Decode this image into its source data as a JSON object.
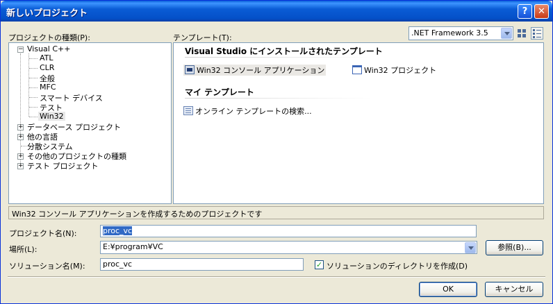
{
  "window": {
    "title": "新しいプロジェクト",
    "help_glyph": "?",
    "close_glyph": "✕"
  },
  "labels": {
    "project_types": "プロジェクトの種類(P):",
    "templates": "テンプレート(T):"
  },
  "framework": {
    "selected": ".NET Framework 3.5"
  },
  "tree": {
    "root": {
      "label": "Visual C++",
      "expander": "−"
    },
    "children": [
      "ATL",
      "CLR",
      "全般",
      "MFC",
      "スマート デバイス",
      "テスト",
      "Win32"
    ],
    "top_items": [
      {
        "label": "データベース プロジェクト",
        "expander": "+"
      },
      {
        "label": "他の言語",
        "expander": "+"
      },
      {
        "label": "分散システム",
        "expander": ""
      },
      {
        "label": "その他のプロジェクトの種類",
        "expander": "+"
      },
      {
        "label": "テスト プロジェクト",
        "expander": "+"
      }
    ]
  },
  "templates": {
    "installed_header": "Visual Studio にインストールされたテンプレート",
    "installed": [
      {
        "label": "Win32 コンソール アプリケーション",
        "icon": "console-app-icon"
      },
      {
        "label": "Win32 プロジェクト",
        "icon": "win32-project-icon"
      }
    ],
    "my_header": "マイ テンプレート",
    "my": [
      {
        "label": "オンライン テンプレートの検索...",
        "icon": "online-search-icon"
      }
    ]
  },
  "description": "Win32 コンソール アプリケーションを作成するためのプロジェクトです",
  "form": {
    "name_label": "プロジェクト名(N):",
    "name_value": "proc_vc",
    "location_label": "場所(L):",
    "location_value": "E:¥program¥VC",
    "browse_button": "参照(B)...",
    "solution_label": "ソリューション名(M):",
    "solution_value": "proc_vc",
    "create_dir_label": "ソリューションのディレクトリを作成(D)",
    "create_dir_checked": "✓"
  },
  "buttons": {
    "ok": "OK",
    "cancel": "キャンセル"
  }
}
